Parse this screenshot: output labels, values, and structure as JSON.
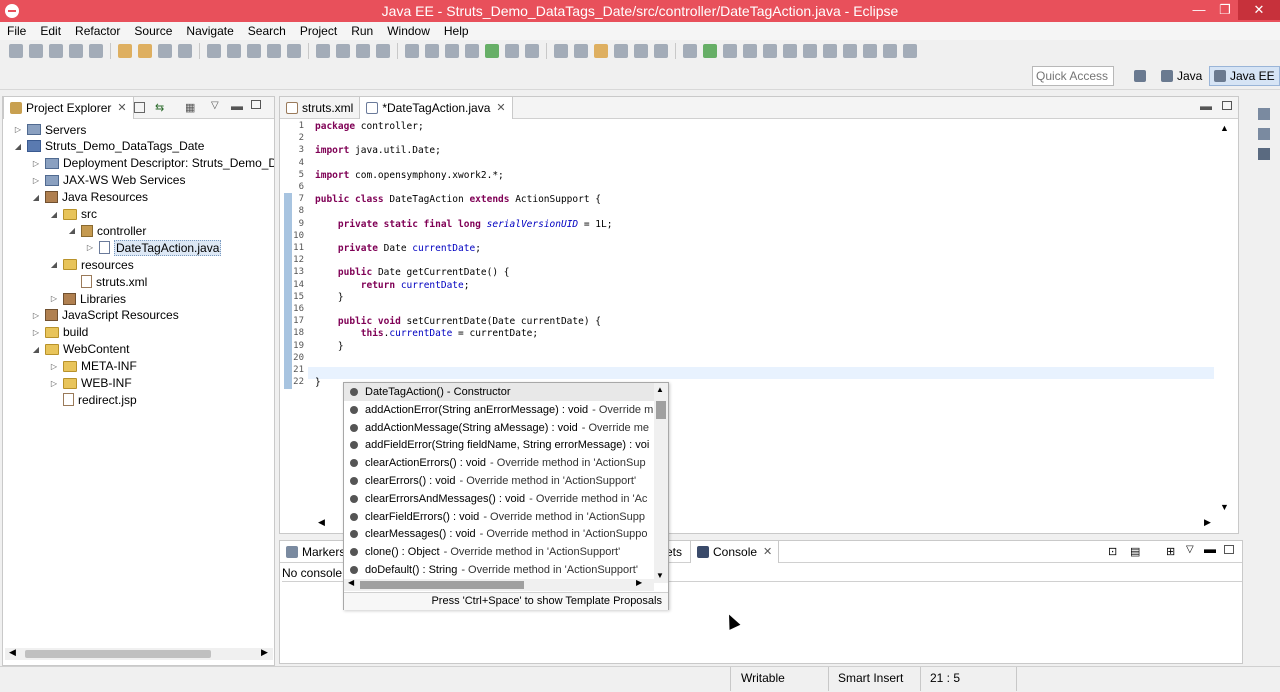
{
  "window": {
    "title": "Java EE - Struts_Demo_DataTags_Date/src/controller/DateTagAction.java - Eclipse"
  },
  "menu": [
    "File",
    "Edit",
    "Refactor",
    "Source",
    "Navigate",
    "Search",
    "Project",
    "Run",
    "Window",
    "Help"
  ],
  "quick_access": {
    "placeholder": "Quick Access"
  },
  "perspectives": [
    {
      "label": "Java",
      "active": false
    },
    {
      "label": "Java EE",
      "active": true
    }
  ],
  "project_explorer": {
    "tab_label": "Project Explorer",
    "items": [
      {
        "label": "Servers",
        "icon": "server-icon",
        "depth": 0,
        "arrow": "right"
      },
      {
        "label": "Struts_Demo_DataTags_Date",
        "icon": "project-icon",
        "depth": 0,
        "arrow": "down"
      },
      {
        "label": "Deployment Descriptor: Struts_Demo_Date",
        "icon": "descriptor-icon",
        "depth": 1,
        "arrow": "right"
      },
      {
        "label": "JAX-WS Web Services",
        "icon": "webservice-icon",
        "depth": 1,
        "arrow": "right"
      },
      {
        "label": "Java Resources",
        "icon": "java-resources-icon",
        "depth": 1,
        "arrow": "down"
      },
      {
        "label": "src",
        "icon": "folder-icon",
        "depth": 2,
        "arrow": "down"
      },
      {
        "label": "controller",
        "icon": "package-icon",
        "depth": 3,
        "arrow": "down"
      },
      {
        "label": "DateTagAction.java",
        "icon": "java-file-icon",
        "depth": 4,
        "arrow": "right",
        "selected": true
      },
      {
        "label": "resources",
        "icon": "folder-icon",
        "depth": 2,
        "arrow": "down"
      },
      {
        "label": "struts.xml",
        "icon": "xml-file-icon",
        "depth": 3,
        "arrow": ""
      },
      {
        "label": "Libraries",
        "icon": "library-icon",
        "depth": 2,
        "arrow": "right"
      },
      {
        "label": "JavaScript Resources",
        "icon": "js-resources-icon",
        "depth": 1,
        "arrow": "right"
      },
      {
        "label": "build",
        "icon": "folder-icon",
        "depth": 1,
        "arrow": "right"
      },
      {
        "label": "WebContent",
        "icon": "folder-icon",
        "depth": 1,
        "arrow": "down"
      },
      {
        "label": "META-INF",
        "icon": "folder-icon",
        "depth": 2,
        "arrow": "right"
      },
      {
        "label": "WEB-INF",
        "icon": "folder-icon",
        "depth": 2,
        "arrow": "right"
      },
      {
        "label": "redirect.jsp",
        "icon": "jsp-file-icon",
        "depth": 2,
        "arrow": ""
      }
    ]
  },
  "editor": {
    "tabs": [
      {
        "label": "struts.xml",
        "active": false
      },
      {
        "label": "*DateTagAction.java",
        "active": true
      }
    ],
    "lines": [
      {
        "n": "1",
        "html": "<span class=\"kw\">package</span> controller;"
      },
      {
        "n": "2",
        "html": ""
      },
      {
        "n": "3",
        "html": "<span class=\"kw\">import</span> java.util.Date;"
      },
      {
        "n": "4",
        "html": ""
      },
      {
        "n": "5",
        "html": "<span class=\"kw\">import</span> com.opensymphony.xwork2.*;"
      },
      {
        "n": "6",
        "html": ""
      },
      {
        "n": "7",
        "html": "<span class=\"kw\">public class</span> DateTagAction <span class=\"kw\">extends</span> ActionSupport {"
      },
      {
        "n": "8",
        "html": ""
      },
      {
        "n": "9",
        "html": "    <span class=\"kw\">private static final long</span> <span class=\"fld\">serialVersionUID</span> = 1L;"
      },
      {
        "n": "10",
        "html": ""
      },
      {
        "n": "11",
        "html": "    <span class=\"kw\">private</span> Date <span class=\"fld2\">currentDate</span>;"
      },
      {
        "n": "12",
        "html": ""
      },
      {
        "n": "13",
        "html": "    <span class=\"kw\">public</span> Date getCurrentDate() {"
      },
      {
        "n": "14",
        "html": "        <span class=\"kw\">return</span> <span class=\"fld2\">currentDate</span>;"
      },
      {
        "n": "15",
        "html": "    }"
      },
      {
        "n": "16",
        "html": ""
      },
      {
        "n": "17",
        "html": "    <span class=\"kw\">public void</span> setCurrentDate(Date currentDate) {"
      },
      {
        "n": "18",
        "html": "        <span class=\"kw\">this</span>.<span class=\"fld2\">currentDate</span> = currentDate;"
      },
      {
        "n": "19",
        "html": "    }"
      },
      {
        "n": "20",
        "html": ""
      },
      {
        "n": "21",
        "html": ""
      },
      {
        "n": "22",
        "html": "}"
      }
    ]
  },
  "content_assist": {
    "items": [
      {
        "name": "DateTagAction() - Constructor",
        "desc": ""
      },
      {
        "name": "addActionError(String anErrorMessage) : void",
        "desc": "- Override m"
      },
      {
        "name": "addActionMessage(String aMessage) : void",
        "desc": "- Override me"
      },
      {
        "name": "addFieldError(String fieldName, String errorMessage) : voi",
        "desc": ""
      },
      {
        "name": "clearActionErrors() : void",
        "desc": "- Override method in 'ActionSup"
      },
      {
        "name": "clearErrors() : void",
        "desc": "- Override method in 'ActionSupport'"
      },
      {
        "name": "clearErrorsAndMessages() : void",
        "desc": "- Override method in 'Ac"
      },
      {
        "name": "clearFieldErrors() : void",
        "desc": "- Override method in 'ActionSupp"
      },
      {
        "name": "clearMessages() : void",
        "desc": "- Override method in 'ActionSuppo"
      },
      {
        "name": "clone() : Object",
        "desc": "- Override method in 'ActionSupport'"
      },
      {
        "name": "doDefault() : String",
        "desc": "- Override method in 'ActionSupport'"
      }
    ],
    "footer": "Press 'Ctrl+Space' to show Template Proposals"
  },
  "bottom_panel": {
    "tabs": [
      {
        "label": "Markers",
        "active": false
      },
      {
        "label": "ets",
        "active": false
      },
      {
        "label": "Console",
        "active": true
      }
    ],
    "content": "No console"
  },
  "status": {
    "writable": "Writable",
    "insert_mode": "Smart Insert",
    "position": "21 : 5"
  }
}
